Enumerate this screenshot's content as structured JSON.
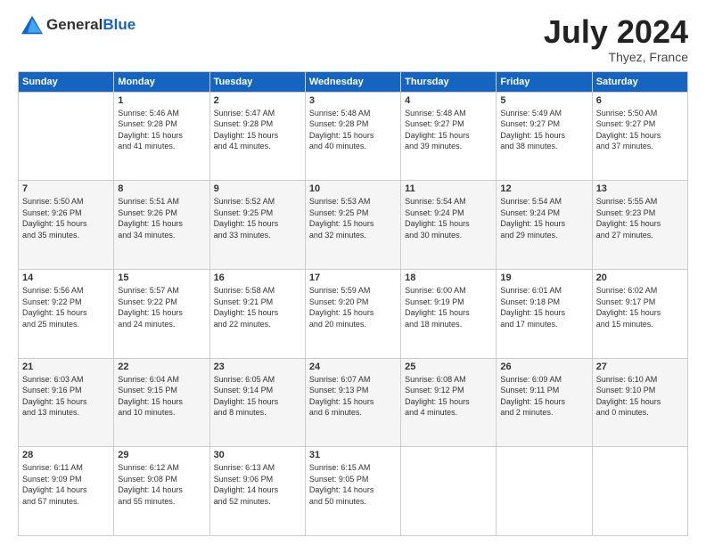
{
  "header": {
    "logo_general": "General",
    "logo_blue": "Blue",
    "month_year": "July 2024",
    "location": "Thyez, France"
  },
  "calendar": {
    "days_of_week": [
      "Sunday",
      "Monday",
      "Tuesday",
      "Wednesday",
      "Thursday",
      "Friday",
      "Saturday"
    ],
    "weeks": [
      [
        {
          "day": "",
          "content": ""
        },
        {
          "day": "1",
          "content": "Sunrise: 5:46 AM\nSunset: 9:28 PM\nDaylight: 15 hours\nand 41 minutes."
        },
        {
          "day": "2",
          "content": "Sunrise: 5:47 AM\nSunset: 9:28 PM\nDaylight: 15 hours\nand 41 minutes."
        },
        {
          "day": "3",
          "content": "Sunrise: 5:48 AM\nSunset: 9:28 PM\nDaylight: 15 hours\nand 40 minutes."
        },
        {
          "day": "4",
          "content": "Sunrise: 5:48 AM\nSunset: 9:27 PM\nDaylight: 15 hours\nand 39 minutes."
        },
        {
          "day": "5",
          "content": "Sunrise: 5:49 AM\nSunset: 9:27 PM\nDaylight: 15 hours\nand 38 minutes."
        },
        {
          "day": "6",
          "content": "Sunrise: 5:50 AM\nSunset: 9:27 PM\nDaylight: 15 hours\nand 37 minutes."
        }
      ],
      [
        {
          "day": "7",
          "content": "Sunrise: 5:50 AM\nSunset: 9:26 PM\nDaylight: 15 hours\nand 35 minutes."
        },
        {
          "day": "8",
          "content": "Sunrise: 5:51 AM\nSunset: 9:26 PM\nDaylight: 15 hours\nand 34 minutes."
        },
        {
          "day": "9",
          "content": "Sunrise: 5:52 AM\nSunset: 9:25 PM\nDaylight: 15 hours\nand 33 minutes."
        },
        {
          "day": "10",
          "content": "Sunrise: 5:53 AM\nSunset: 9:25 PM\nDaylight: 15 hours\nand 32 minutes."
        },
        {
          "day": "11",
          "content": "Sunrise: 5:54 AM\nSunset: 9:24 PM\nDaylight: 15 hours\nand 30 minutes."
        },
        {
          "day": "12",
          "content": "Sunrise: 5:54 AM\nSunset: 9:24 PM\nDaylight: 15 hours\nand 29 minutes."
        },
        {
          "day": "13",
          "content": "Sunrise: 5:55 AM\nSunset: 9:23 PM\nDaylight: 15 hours\nand 27 minutes."
        }
      ],
      [
        {
          "day": "14",
          "content": "Sunrise: 5:56 AM\nSunset: 9:22 PM\nDaylight: 15 hours\nand 25 minutes."
        },
        {
          "day": "15",
          "content": "Sunrise: 5:57 AM\nSunset: 9:22 PM\nDaylight: 15 hours\nand 24 minutes."
        },
        {
          "day": "16",
          "content": "Sunrise: 5:58 AM\nSunset: 9:21 PM\nDaylight: 15 hours\nand 22 minutes."
        },
        {
          "day": "17",
          "content": "Sunrise: 5:59 AM\nSunset: 9:20 PM\nDaylight: 15 hours\nand 20 minutes."
        },
        {
          "day": "18",
          "content": "Sunrise: 6:00 AM\nSunset: 9:19 PM\nDaylight: 15 hours\nand 18 minutes."
        },
        {
          "day": "19",
          "content": "Sunrise: 6:01 AM\nSunset: 9:18 PM\nDaylight: 15 hours\nand 17 minutes."
        },
        {
          "day": "20",
          "content": "Sunrise: 6:02 AM\nSunset: 9:17 PM\nDaylight: 15 hours\nand 15 minutes."
        }
      ],
      [
        {
          "day": "21",
          "content": "Sunrise: 6:03 AM\nSunset: 9:16 PM\nDaylight: 15 hours\nand 13 minutes."
        },
        {
          "day": "22",
          "content": "Sunrise: 6:04 AM\nSunset: 9:15 PM\nDaylight: 15 hours\nand 10 minutes."
        },
        {
          "day": "23",
          "content": "Sunrise: 6:05 AM\nSunset: 9:14 PM\nDaylight: 15 hours\nand 8 minutes."
        },
        {
          "day": "24",
          "content": "Sunrise: 6:07 AM\nSunset: 9:13 PM\nDaylight: 15 hours\nand 6 minutes."
        },
        {
          "day": "25",
          "content": "Sunrise: 6:08 AM\nSunset: 9:12 PM\nDaylight: 15 hours\nand 4 minutes."
        },
        {
          "day": "26",
          "content": "Sunrise: 6:09 AM\nSunset: 9:11 PM\nDaylight: 15 hours\nand 2 minutes."
        },
        {
          "day": "27",
          "content": "Sunrise: 6:10 AM\nSunset: 9:10 PM\nDaylight: 15 hours\nand 0 minutes."
        }
      ],
      [
        {
          "day": "28",
          "content": "Sunrise: 6:11 AM\nSunset: 9:09 PM\nDaylight: 14 hours\nand 57 minutes."
        },
        {
          "day": "29",
          "content": "Sunrise: 6:12 AM\nSunset: 9:08 PM\nDaylight: 14 hours\nand 55 minutes."
        },
        {
          "day": "30",
          "content": "Sunrise: 6:13 AM\nSunset: 9:06 PM\nDaylight: 14 hours\nand 52 minutes."
        },
        {
          "day": "31",
          "content": "Sunrise: 6:15 AM\nSunset: 9:05 PM\nDaylight: 14 hours\nand 50 minutes."
        },
        {
          "day": "",
          "content": ""
        },
        {
          "day": "",
          "content": ""
        },
        {
          "day": "",
          "content": ""
        }
      ]
    ]
  }
}
